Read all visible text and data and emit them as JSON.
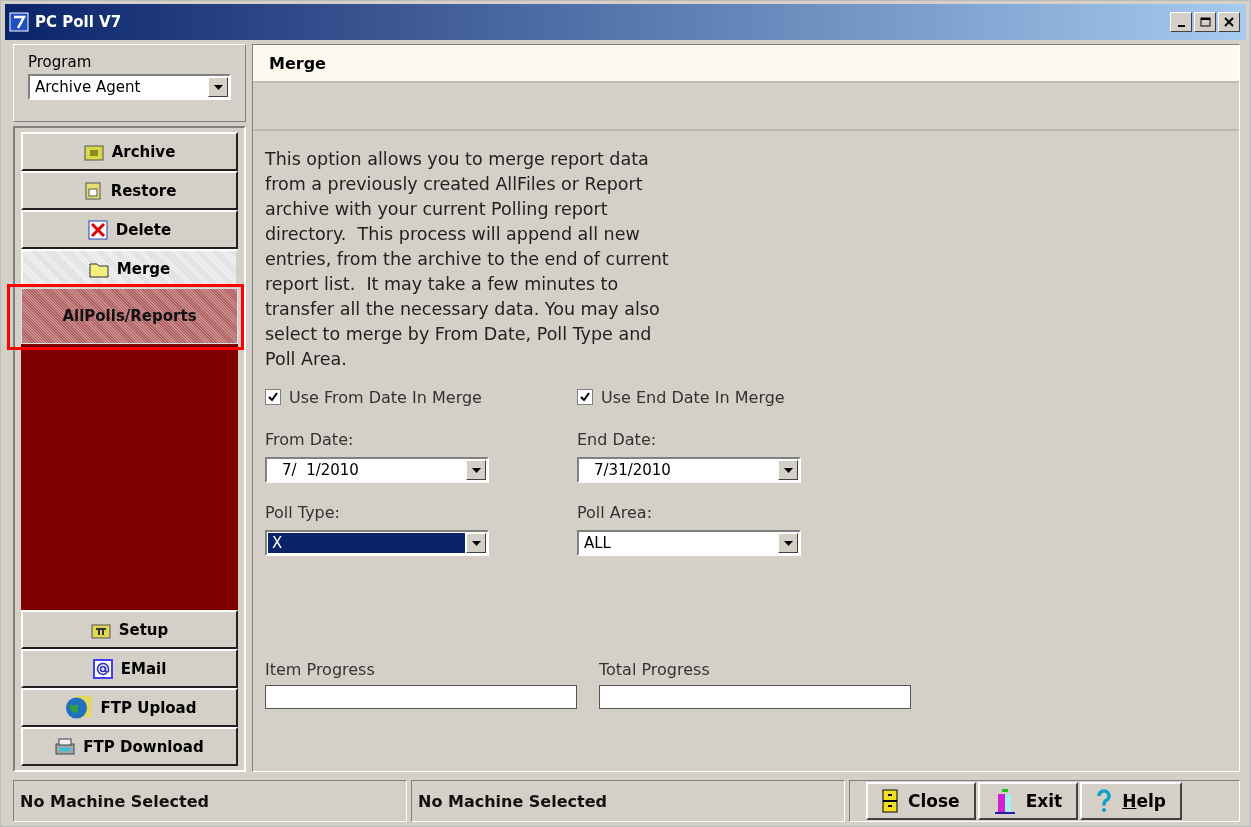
{
  "window": {
    "title": "PC Poll V7"
  },
  "program": {
    "label": "Program",
    "value": "Archive Agent"
  },
  "nav_top": [
    {
      "label": "Archive",
      "kind": "archive",
      "selected": false
    },
    {
      "label": "Restore",
      "kind": "restore",
      "selected": false
    },
    {
      "label": "Delete",
      "kind": "delete",
      "selected": false
    },
    {
      "label": "Merge",
      "kind": "merge",
      "selected": true,
      "children": [
        {
          "label": "AllPolls/Reports",
          "selected": true,
          "highlighted": true
        }
      ]
    }
  ],
  "nav_bottom": [
    {
      "label": "Setup",
      "kind": "setup",
      "selected": false
    },
    {
      "label": "EMail",
      "kind": "email",
      "selected": false
    },
    {
      "label": "FTP Upload",
      "kind": "upload",
      "selected": false
    },
    {
      "label": "FTP Download",
      "kind": "download",
      "selected": false
    }
  ],
  "panel": {
    "title": "Merge",
    "description": "This option allows you to merge report data\nfrom a previously created AllFiles or Report\narchive with your current Polling report\ndirectory.  This process will append all new\nentries, from the archive to the end of current\nreport list.  It may take a few minutes to\ntransfer all the necessary data. You may also\nselect to merge by From Date, Poll Type and\nPoll Area.",
    "checkboxes": [
      {
        "label": "Use From Date In Merge",
        "checked": true
      },
      {
        "label": "Use End Date In Merge",
        "checked": true
      }
    ],
    "fields": [
      {
        "label": "From Date:",
        "value": "7/  1/2010",
        "selected": false
      },
      {
        "label": "End Date:",
        "value": "7/31/2010",
        "selected": false
      },
      {
        "label": "Poll Type:",
        "value": "X",
        "selected": true
      },
      {
        "label": "Poll Area:",
        "value": "ALL",
        "selected": false
      }
    ],
    "progress": [
      {
        "label": "Item Progress",
        "level": 0
      },
      {
        "label": "Total Progress",
        "level": 0
      }
    ]
  },
  "status_bar": [
    "No Machine Selected",
    "No Machine Selected"
  ],
  "buttons": [
    {
      "label": "Close",
      "kind": "close",
      "underline_first": false
    },
    {
      "label": "Exit",
      "kind": "exit",
      "underline_first": false
    },
    {
      "label": "Help",
      "kind": "help",
      "underline_first": true
    }
  ]
}
